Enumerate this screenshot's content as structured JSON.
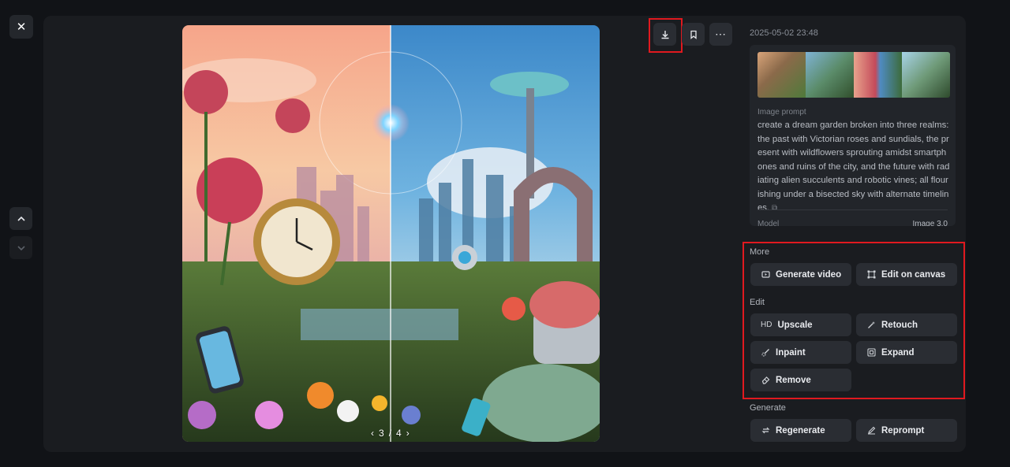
{
  "viewer": {
    "pager": {
      "current": "3",
      "separator": "/",
      "total": "4"
    }
  },
  "info": {
    "timestamp": "2025-05-02 23:48",
    "prompt_label": "Image prompt",
    "prompt_text": "create a dream garden broken into three realms: the past with Victorian roses and sundials, the present with wildflowers sprouting amidst smartphones and ruins of the city, and the future with radiating alien succulents and robotic vines; all flourishing under a bisected sky with alternate timelines.",
    "model_label": "Model",
    "model_value": "Image 3.0"
  },
  "sections": {
    "more_label": "More",
    "edit_label": "Edit",
    "generate_label": "Generate"
  },
  "buttons": {
    "generate_video": "Generate video",
    "edit_on_canvas": "Edit on canvas",
    "upscale_prefix": "HD",
    "upscale": "Upscale",
    "retouch": "Retouch",
    "inpaint": "Inpaint",
    "expand": "Expand",
    "remove": "Remove",
    "regenerate": "Regenerate",
    "reprompt": "Reprompt"
  },
  "colors": {
    "background": "#111317",
    "panel": "#1a1c20",
    "button": "#2a2d33",
    "highlight": "#e0191f"
  },
  "icons": {
    "close": "close-icon",
    "up": "chevron-up-icon",
    "down": "chevron-down-icon",
    "download": "download-icon",
    "bookmark": "bookmark-icon",
    "more": "more-icon"
  }
}
